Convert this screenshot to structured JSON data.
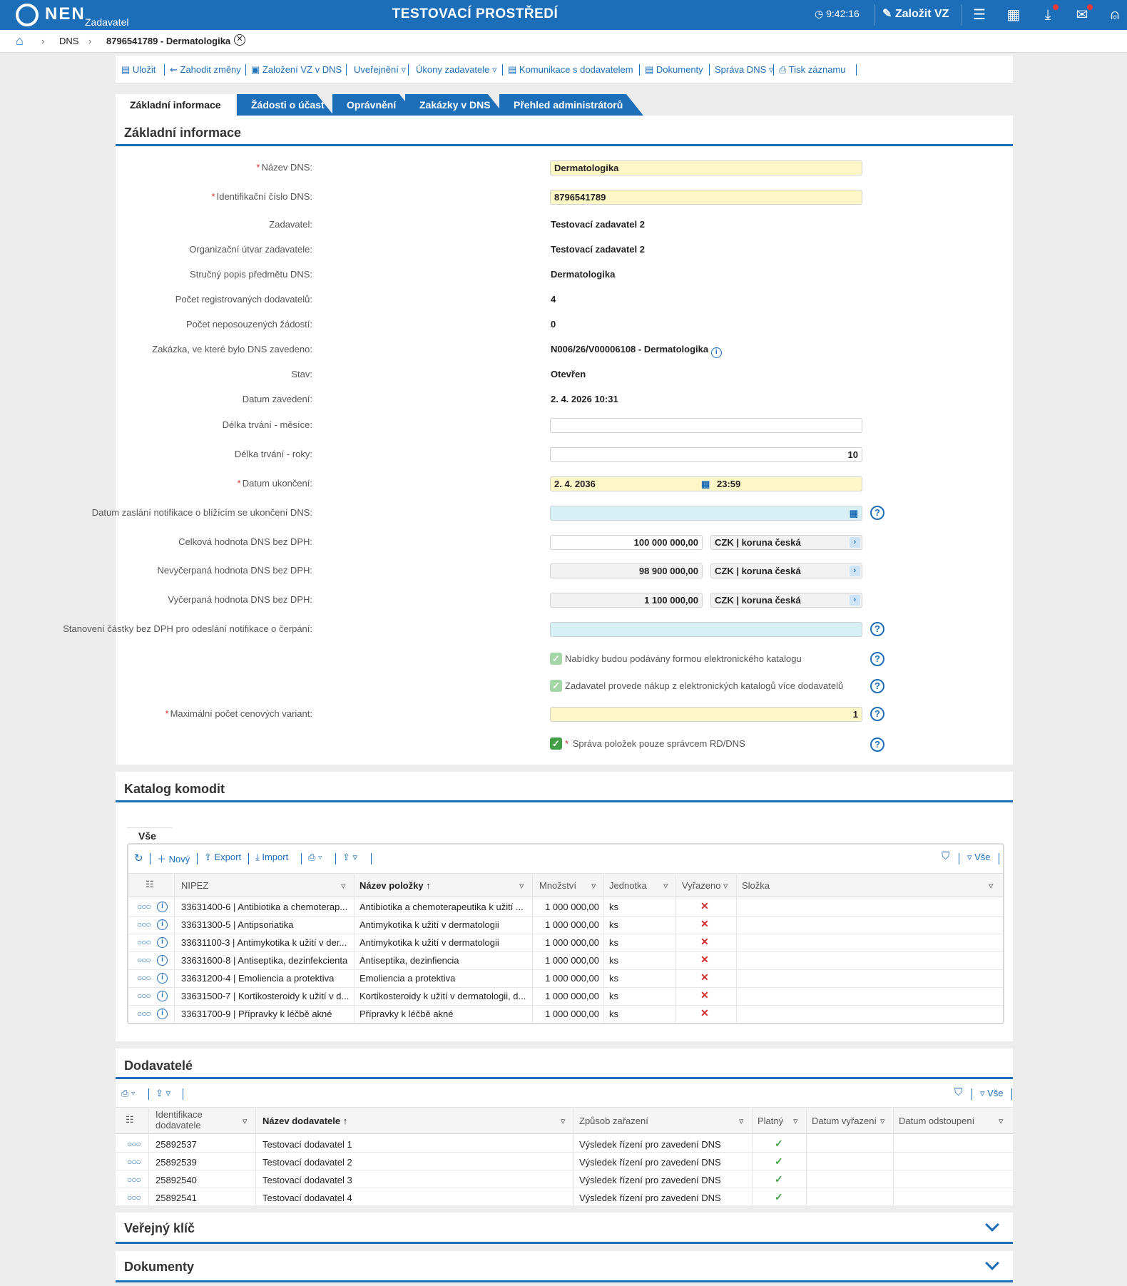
{
  "topbar": {
    "logo": "NEN",
    "logo_sub": "Zadavatel",
    "environment": "TESTOVACÍ PROSTŘEDÍ",
    "clock": "9:42:16",
    "create_vz": "Založit VZ"
  },
  "breadcrumb": {
    "home": "⌂",
    "dns": "DNS",
    "current": "8796541789 - Dermatologika"
  },
  "toolbar": {
    "items": [
      "Uložit",
      "Zahodit změny",
      "Založení VZ v DNS",
      "Uveřejnění ▿",
      "Úkony zadavatele ▿",
      "Komunikace s dodavatelem",
      "Dokumenty",
      "Správa DNS ▿",
      "Tisk záznamu"
    ]
  },
  "tabs": [
    "Základní informace",
    "Žádosti o účast",
    "Oprávnění",
    "Zakázky v DNS",
    "Přehled administrátorů"
  ],
  "basic": {
    "title": "Základní informace",
    "labels": {
      "name": "Název DNS:",
      "id": "Identifikační číslo DNS:",
      "zadavatel": "Zadavatel:",
      "utvar": "Organizační útvar zadavatele:",
      "popis": "Stručný popis předmětu DNS:",
      "pocet_dod": "Počet registrovaných dodavatelů:",
      "pocet_zad": "Počet neposouzených žádostí:",
      "zakazka": "Zakázka, ve které bylo DNS zavedeno:",
      "stav": "Stav:",
      "datum_zav": "Datum zavedení:",
      "delka_m": "Délka trvání - měsíce:",
      "delka_r": "Délka trvání - roky:",
      "datum_uk": "Datum ukončení:",
      "notif": "Datum zaslání notifikace o blížícím se ukončení DNS:",
      "celkova": "Celková hodnota DNS bez DPH:",
      "nevycerpana": "Nevyčerpaná hodnota DNS bez DPH:",
      "vycerpana": "Vyčerpaná hodnota DNS bez DPH:",
      "castka": "Stanovení částky bez DPH pro odeslání notifikace o čerpání:",
      "max": "Maximální počet cenových variant:"
    },
    "values": {
      "name": "Dermatologika",
      "id": "8796541789",
      "zadavatel": "Testovací zadavatel 2",
      "utvar": "Testovací zadavatel 2",
      "popis": "Dermatologika",
      "pocet_dod": "4",
      "pocet_zad": "0",
      "zakazka": "N006/26/V00006108 - Dermatologika",
      "stav": "Otevřen",
      "datum_zav": "2. 4. 2026 10:31",
      "delka_m": "",
      "delka_r": "10",
      "datum_uk_date": "2. 4. 2036",
      "datum_uk_time": "23:59",
      "notif": "",
      "celkova": "100 000 000,00",
      "nevycerpana": "98 900 000,00",
      "vycerpana": "1 100 000,00",
      "currency": "CZK | koruna česká",
      "castka": "",
      "max": "1"
    },
    "checkboxes": [
      "Nabídky budou podávány formou elektronického katalogu",
      "Zadavatel provede nákup z elektronických katalogů více dodavatelů",
      "Správa položek pouze správcem RD/DNS"
    ]
  },
  "katalog": {
    "title": "Katalog komodit",
    "tab": "Vše",
    "toolbar": {
      "new": "Nový",
      "export": "Export",
      "import": "Import",
      "all": "Vše"
    },
    "headers": [
      "NIPEZ",
      "Název položky",
      "Množství",
      "Jednotka",
      "Vyřazeno",
      "Složka"
    ],
    "rows": [
      [
        "33631400-6 | Antibiotika a chemoterap...",
        "Antibiotika a chemoterapeutika k užití ...",
        "1 000 000,00",
        "ks"
      ],
      [
        "33631300-5 | Antipsoriatika",
        "Antimykotika k užití v dermatologii",
        "1 000 000,00",
        "ks"
      ],
      [
        "33631100-3 | Antimykotika k užití v der...",
        "Antimykotika k užití v dermatologii",
        "1 000 000,00",
        "ks"
      ],
      [
        "33631600-8 | Antiseptika, dezinfekcienta",
        "Antiseptika, dezinfiencia",
        "1 000 000,00",
        "ks"
      ],
      [
        "33631200-4 | Emoliencia a protektiva",
        "Emoliencia a protektiva",
        "1 000 000,00",
        "ks"
      ],
      [
        "33631500-7 | Kortikosteroidy k užití v d...",
        "Kortikosteroidy k užití v dermatologii, d...",
        "1 000 000,00",
        "ks"
      ],
      [
        "33631700-9 | Přípravky k léčbě akné",
        "Přípravky k léčbě akné",
        "1 000 000,00",
        "ks"
      ]
    ]
  },
  "dodavatele": {
    "title": "Dodavatelé",
    "all": "Vše",
    "headers": [
      "Identifikace dodavatele",
      "Název dodavatele",
      "Způsob zařazení",
      "Platný",
      "Datum vyřazení",
      "Datum odstoupení"
    ],
    "rows": [
      [
        "25892537",
        "Testovací dodavatel 1",
        "Výsledek řízení pro zavedení DNS"
      ],
      [
        "25892539",
        "Testovací dodavatel 2",
        "Výsledek řízení pro zavedení DNS"
      ],
      [
        "25892540",
        "Testovací dodavatel 3",
        "Výsledek řízení pro zavedení DNS"
      ],
      [
        "25892541",
        "Testovací dodavatel 4",
        "Výsledek řízení pro zavedení DNS"
      ]
    ]
  },
  "sections": {
    "klic": "Veřejný klíč",
    "dokumenty": "Dokumenty"
  }
}
